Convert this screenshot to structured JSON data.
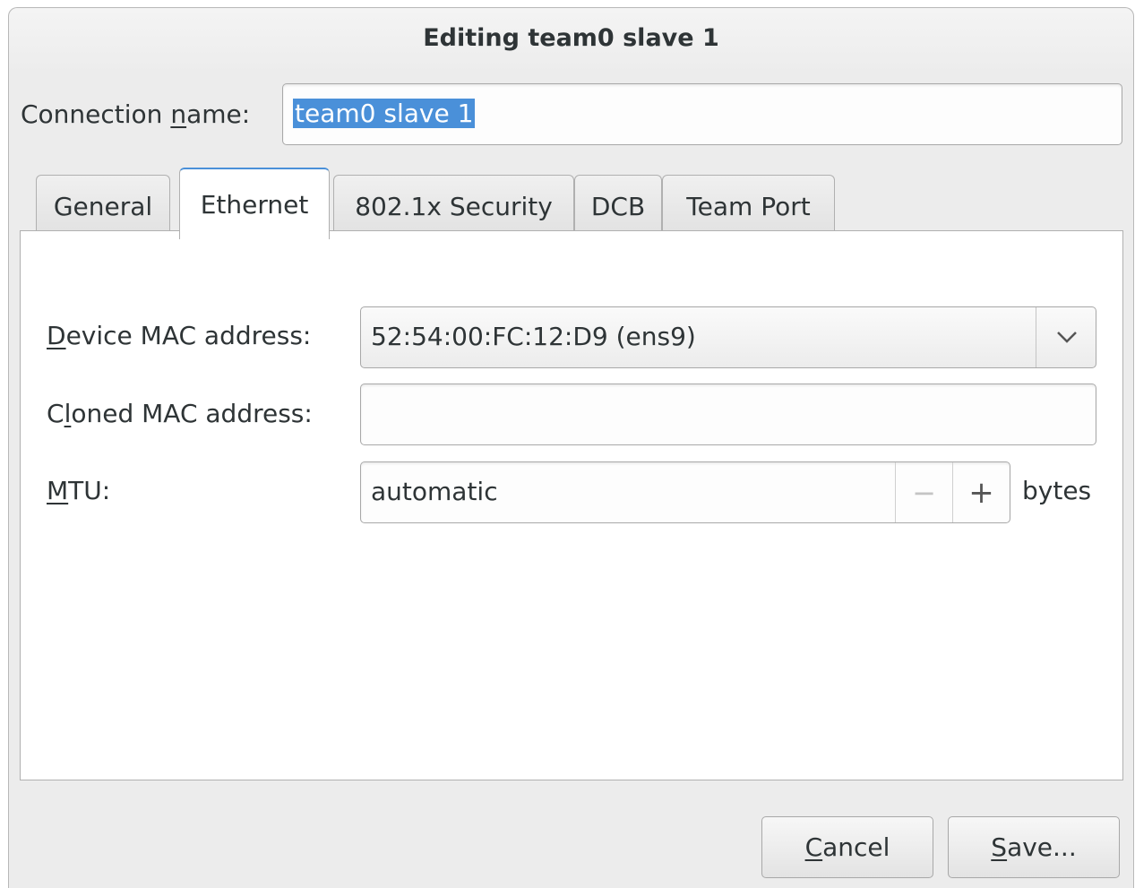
{
  "window": {
    "title": "Editing team0 slave 1"
  },
  "connection_name": {
    "label": "Connection ",
    "label_mnemonic": "n",
    "label_rest": "ame:",
    "value": "team0 slave 1"
  },
  "tabs": [
    {
      "label": "General"
    },
    {
      "label": "Ethernet"
    },
    {
      "label": "802.1x Security"
    },
    {
      "label": "DCB"
    },
    {
      "label": "Team Port"
    }
  ],
  "ethernet": {
    "device_mac": {
      "label_mnemonic": "D",
      "label_rest": "evice MAC address:",
      "value": "52:54:00:FC:12:D9 (ens9)"
    },
    "cloned_mac": {
      "label_pre": "C",
      "label_mnemonic": "l",
      "label_rest": "oned MAC address:",
      "value": ""
    },
    "mtu": {
      "label_mnemonic": "M",
      "label_rest": "TU:",
      "value": "automatic",
      "unit": "bytes",
      "decrement": "−",
      "increment": "+"
    }
  },
  "buttons": {
    "cancel": {
      "mnemonic": "C",
      "rest": "ancel"
    },
    "save": {
      "mnemonic": "S",
      "rest": "ave..."
    }
  }
}
